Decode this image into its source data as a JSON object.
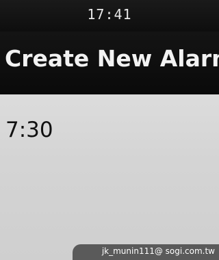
{
  "status_bar": {
    "clock": "17:41"
  },
  "header": {
    "title": "Create New Alarm"
  },
  "main": {
    "alarm_time": "7:30"
  },
  "watermark": {
    "text": "jk_munin111@ sogi.com.tw"
  },
  "colors": {
    "background_dark": "#0b0b0b",
    "content_background": "#d4d4d4",
    "title_text": "#f2f2f2",
    "body_text": "#111111"
  }
}
